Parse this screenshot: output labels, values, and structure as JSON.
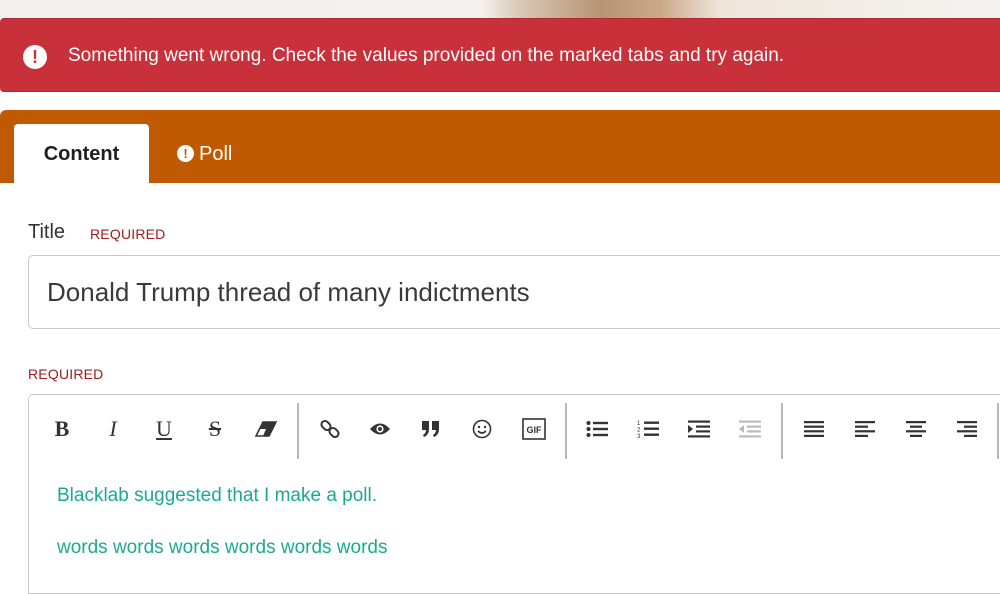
{
  "alert": {
    "icon": "exclamation-circle-icon",
    "message": "Something went wrong. Check the values provided on the marked tabs and try again."
  },
  "tabs": [
    {
      "label": "Content",
      "active": true
    },
    {
      "label": "Poll",
      "active": false,
      "icon": "exclamation-circle-icon"
    }
  ],
  "title_field": {
    "label": "Title",
    "required_label": "REQUIRED",
    "value": "Donald Trump thread of many indictments"
  },
  "body_field": {
    "required_label": "REQUIRED",
    "toolbar": {
      "bold": "B",
      "italic": "I",
      "underline": "U",
      "strike": "S",
      "icons": [
        "eraser-icon",
        "link-icon",
        "eye-icon",
        "quote-icon",
        "smiley-icon",
        "gif-icon",
        "bullet-list-icon",
        "numbered-list-icon",
        "indent-icon",
        "outdent-icon",
        "justify-icon",
        "align-left-icon",
        "align-center-icon",
        "align-right-icon"
      ],
      "gif_label": "GIF"
    },
    "lines": [
      "Blacklab suggested that I make a poll.",
      "words words words words words words"
    ]
  },
  "colors": {
    "alert": "#c8313a",
    "tabbar": "#bf5a00",
    "required": "#a01c1c",
    "editor_text": "#1aaa90"
  }
}
